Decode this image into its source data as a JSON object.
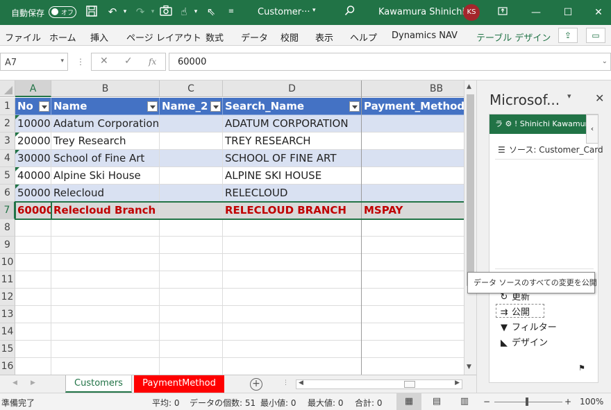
{
  "titlebar": {
    "autosave_label": "自動保存",
    "autosave_state": "オフ",
    "filename": "Customer···",
    "username": "Kawamura Shinichi",
    "avatar_initials": "KS",
    "accent": "#217346"
  },
  "ribbon": {
    "tabs": [
      "ファイル",
      "ホーム",
      "挿入",
      "ページ レイアウト",
      "数式",
      "データ",
      "校閲",
      "表示",
      "ヘルプ",
      "Dynamics NAV",
      "テーブル デザイン"
    ]
  },
  "formula_bar": {
    "name_box": "A7",
    "value": "60000"
  },
  "grid": {
    "column_letters": [
      "A",
      "B",
      "C",
      "D",
      "BB"
    ],
    "row_numbers": [
      "1",
      "2",
      "3",
      "4",
      "5",
      "6",
      "7",
      "8",
      "9",
      "10",
      "11",
      "12",
      "13",
      "14",
      "15",
      "16"
    ],
    "headers": [
      "No",
      "Name",
      "Name_2",
      "Search_Name",
      "Payment_Method_C"
    ],
    "rows": [
      [
        "10000",
        "Adatum Corporation",
        "",
        "ADATUM CORPORATION",
        ""
      ],
      [
        "20000",
        "Trey Research",
        "",
        "TREY RESEARCH",
        ""
      ],
      [
        "30000",
        "School of Fine Art",
        "",
        "SCHOOL OF FINE ART",
        ""
      ],
      [
        "40000",
        "Alpine Ski House",
        "",
        "ALPINE SKI HOUSE",
        ""
      ],
      [
        "50000",
        "Relecloud",
        "",
        "RELECLOUD",
        ""
      ],
      [
        "60000",
        "Relecloud Branch",
        "",
        "RELECLOUD BRANCH",
        "MSPAY"
      ]
    ],
    "header_color": "#4472c4",
    "band_color": "#d9e1f2",
    "changed_text_color": "#c00000"
  },
  "sheets": {
    "tabs": [
      "Customers",
      "PaymentMethod"
    ],
    "active": "Customers"
  },
  "task_pane": {
    "title": "Microsof...",
    "addin_header": "ラ ⚙ ! Shinichi Kawamura",
    "source_label": "ソース: Customer_Card",
    "tooltip": "データ ソースのすべての変更を公開",
    "actions": [
      "更新",
      "公開",
      "フィルター",
      "デザイン"
    ]
  },
  "statusbar": {
    "ready": "準備完了",
    "average": "平均: 0",
    "count": "データの個数: 51",
    "min": "最小値: 0",
    "max": "最大値: 0",
    "sum": "合計: 0",
    "zoom": "100%"
  }
}
